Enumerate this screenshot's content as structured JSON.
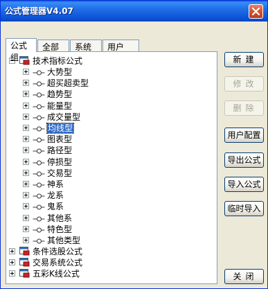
{
  "window": {
    "title": "公式管理器V4.07"
  },
  "tabs": [
    "公式组",
    "全部",
    "系统",
    "用户"
  ],
  "tree": {
    "root": {
      "label": "技术指标公式"
    },
    "children": [
      "大势型",
      "超买超卖型",
      "趋势型",
      "能量型",
      "成交量型",
      "均线型",
      "图表型",
      "路径型",
      "停损型",
      "交易型",
      "神系",
      "龙系",
      "鬼系",
      "其他系",
      "特色型",
      "其他类型"
    ],
    "selected": "均线型",
    "groups": [
      "条件选股公式",
      "交易系统公式",
      "五彩K线公式"
    ]
  },
  "buttons": {
    "new": "新建",
    "modify": "修改",
    "delete": "删除",
    "user_config": "用户配置",
    "export": "导出公式",
    "import": "导入公式",
    "temp_import": "临时导入",
    "close": "关闭"
  },
  "colors": {
    "titlebar": "#0a5fd8",
    "selection": "#316ac5",
    "folder_red": "#cc2222"
  }
}
